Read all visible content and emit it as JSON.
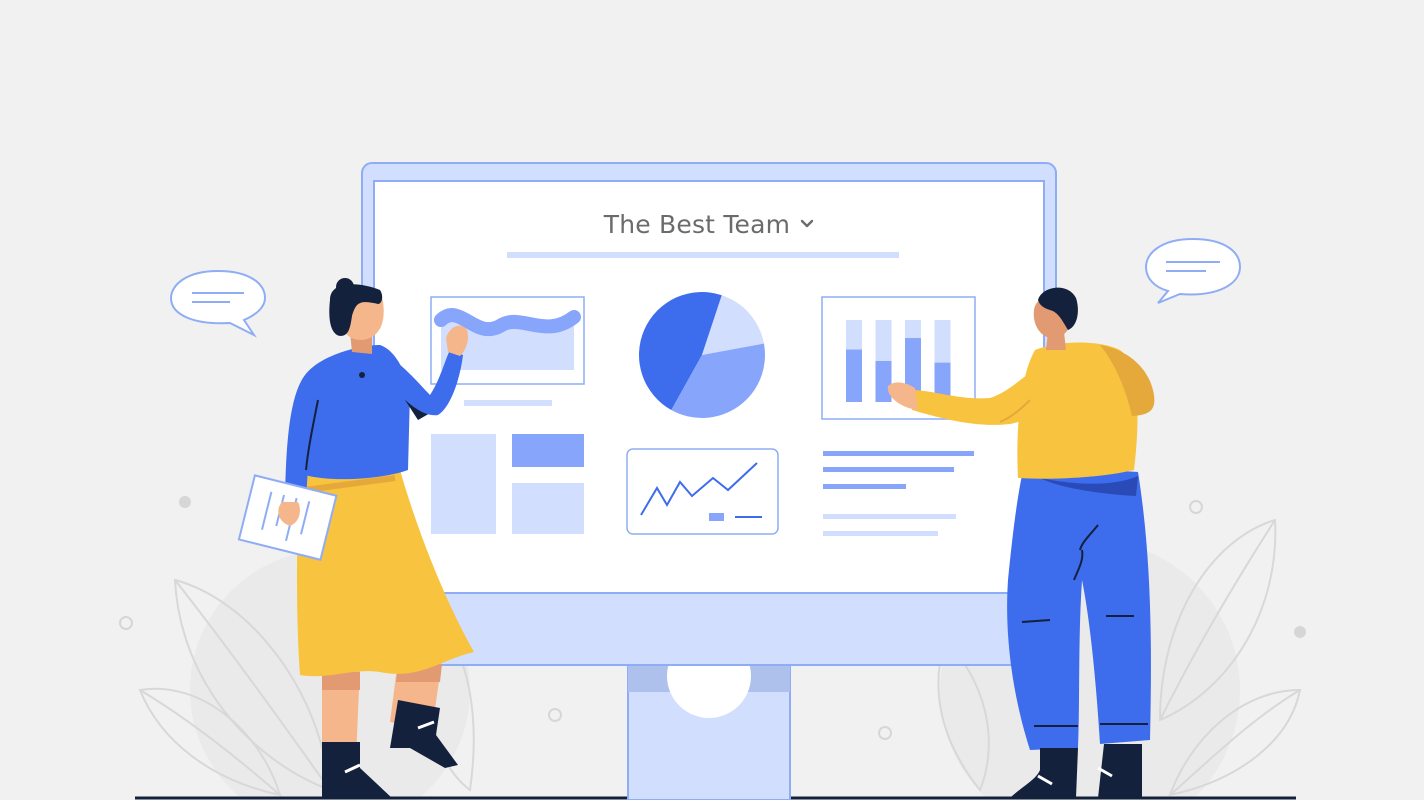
{
  "dashboard": {
    "team_selector_label": "The Best Team",
    "chevron_icon": "chevron-down-icon"
  },
  "palette": {
    "background": "#f1f1f1",
    "monitor_frame": "#d2defd",
    "monitor_outline": "#8fadf5",
    "screen": "#ffffff",
    "primary_blue": "#3d6cec",
    "mid_blue": "#86a5fb",
    "light_blue": "#d2defd",
    "yellow": "#f8c33f",
    "navy": "#14213d",
    "skin": "#f6b68b",
    "leaf_outline": "#d8d8d8"
  },
  "pie_chart": {
    "type": "pie",
    "values": [
      47,
      17,
      36
    ]
  },
  "bar_chart": {
    "type": "bar",
    "values": [
      0.64,
      0.5,
      0.78,
      0.48
    ]
  }
}
